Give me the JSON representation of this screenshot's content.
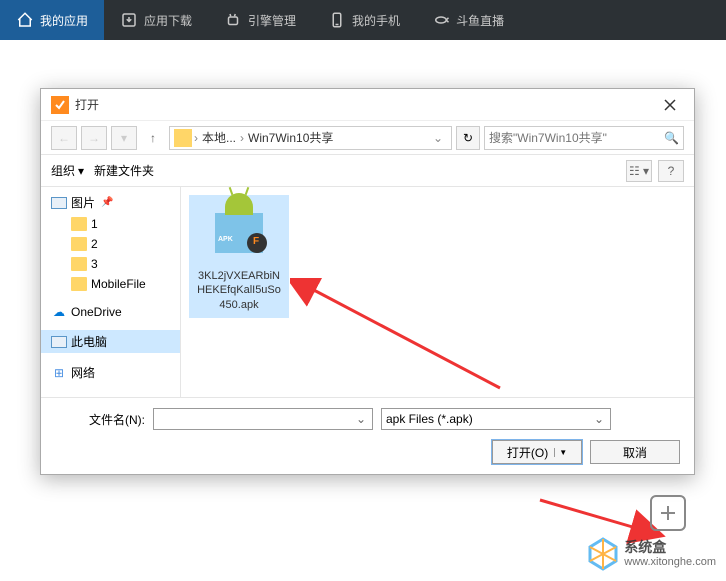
{
  "nav": {
    "items": [
      {
        "label": "我的应用",
        "icon": "home-icon"
      },
      {
        "label": "应用下载",
        "icon": "download-icon"
      },
      {
        "label": "引擎管理",
        "icon": "android-icon"
      },
      {
        "label": "我的手机",
        "icon": "phone-icon"
      },
      {
        "label": "斗鱼直播",
        "icon": "fish-icon"
      }
    ]
  },
  "dialog": {
    "title": "打开",
    "breadcrumb": {
      "root": "本地...",
      "current": "Win7Win10共享"
    },
    "search_placeholder": "搜索\"Win7Win10共享\"",
    "toolbar": {
      "organize": "组织",
      "newfolder": "新建文件夹"
    },
    "tree": [
      {
        "label": "图片",
        "type": "image",
        "level": 1,
        "pinned": true
      },
      {
        "label": "1",
        "type": "folder",
        "level": 2
      },
      {
        "label": "2",
        "type": "folder",
        "level": 2
      },
      {
        "label": "3",
        "type": "folder",
        "level": 2
      },
      {
        "label": "MobileFile",
        "type": "folder",
        "level": 2
      },
      {
        "label": "OneDrive",
        "type": "cloud",
        "level": 1
      },
      {
        "label": "此电脑",
        "type": "pc",
        "level": 1,
        "selected": true
      },
      {
        "label": "网络",
        "type": "network",
        "level": 1
      }
    ],
    "files": [
      {
        "name": "3KL2jVXEARbiNHEKEfqKalI5uSo450.apk",
        "selected": true
      }
    ],
    "footer": {
      "filename_label": "文件名(N):",
      "filter": "apk Files (*.apk)",
      "open": "打开(O)",
      "cancel": "取消"
    }
  },
  "watermark": {
    "title": "系统盒",
    "url": "www.xitonghe.com"
  }
}
